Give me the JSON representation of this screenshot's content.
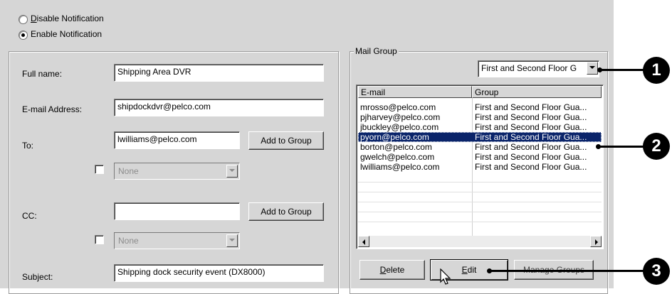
{
  "notification": {
    "disable_label": "Disable Notification",
    "enable_label": "Enable Notification",
    "selected": "enable"
  },
  "form": {
    "full_name_label": "Full name:",
    "full_name_value": "Shipping Area  DVR",
    "email_label": "E-mail Address:",
    "email_value": "shipdockdvr@pelco.com",
    "to_label": "To:",
    "to_value": "lwilliams@pelco.com",
    "to_add_button": "Add to Group",
    "to_group_select": "None",
    "cc_label": "CC:",
    "cc_value": "",
    "cc_add_button": "Add to Group",
    "cc_group_select": "None",
    "subject_label": "Subject:",
    "subject_value": "Shipping dock security event (DX8000)"
  },
  "mail_group": {
    "title": "Mail Group",
    "group_select": "First and Second Floor G",
    "columns": [
      "E-mail",
      "Group"
    ],
    "rows": [
      {
        "email": "mrosso@pelco.com",
        "group": "First and Second Floor Gua..."
      },
      {
        "email": "pjharvey@pelco.com",
        "group": "First and Second Floor Gua..."
      },
      {
        "email": "jbuckley@pelco.com",
        "group": "First and Second Floor Gua..."
      },
      {
        "email": "pyorn@pelco.com",
        "group": "First and Second Floor Gua...",
        "selected": true
      },
      {
        "email": "borton@pelco.com",
        "group": "First and Second Floor Gua..."
      },
      {
        "email": "gwelch@pelco.com",
        "group": "First and Second Floor Gua..."
      },
      {
        "email": "lwilliams@pelco.com",
        "group": "First and Second Floor Gua..."
      }
    ],
    "delete_button": "Delete",
    "edit_button": "Edit",
    "manage_button": "Manage Groups"
  },
  "callouts": [
    "1",
    "2",
    "3"
  ],
  "icons": {
    "dropdown": "chevron-down-icon",
    "scroll_left": "arrow-left-icon",
    "scroll_right": "arrow-right-icon",
    "cursor": "mouse-pointer-icon"
  }
}
